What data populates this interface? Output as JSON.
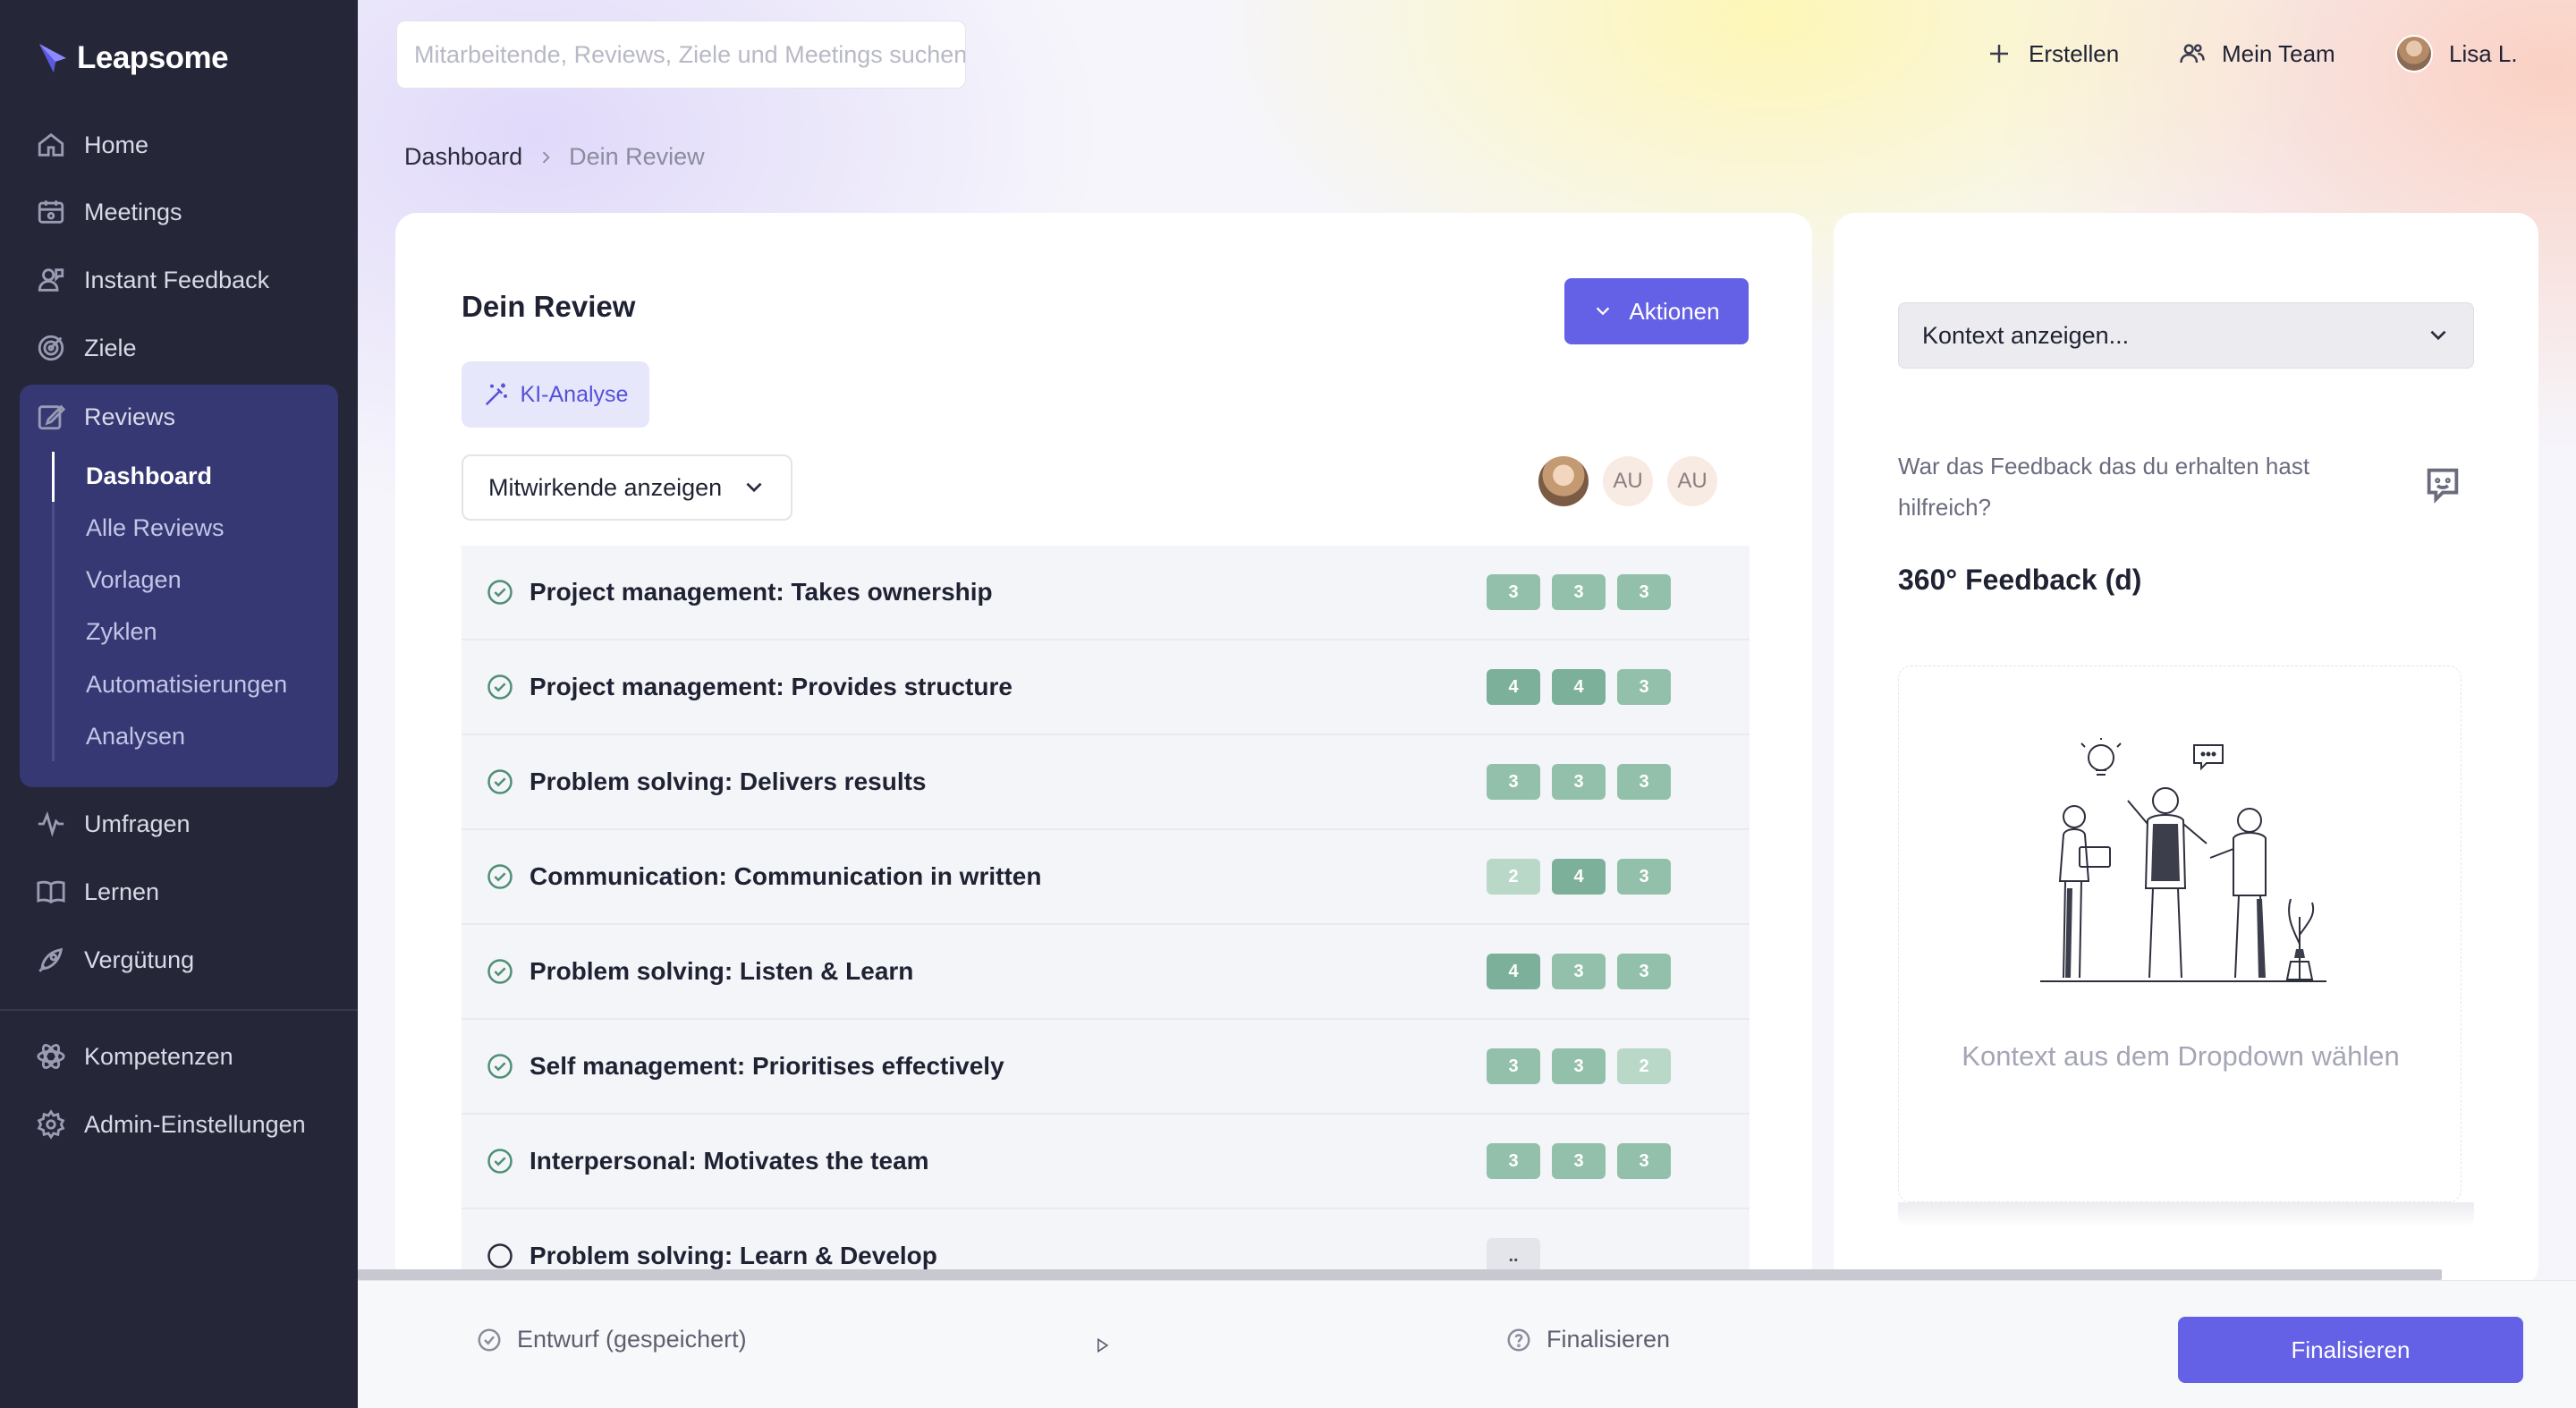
{
  "app": {
    "name": "Leapsome"
  },
  "sidebar": {
    "items": [
      {
        "label": "Home",
        "icon": "home-icon"
      },
      {
        "label": "Meetings",
        "icon": "meetings-icon"
      },
      {
        "label": "Instant Feedback",
        "icon": "feedback-icon"
      },
      {
        "label": "Ziele",
        "icon": "target-icon"
      },
      {
        "label": "Reviews",
        "icon": "reviews-icon"
      },
      {
        "label": "Umfragen",
        "icon": "pulse-icon"
      },
      {
        "label": "Lernen",
        "icon": "book-icon"
      },
      {
        "label": "Vergütung",
        "icon": "rocket-icon"
      },
      {
        "label": "Kompetenzen",
        "icon": "atom-icon"
      },
      {
        "label": "Admin-Einstellungen",
        "icon": "gear-icon"
      }
    ],
    "reviews_sub": [
      {
        "label": "Dashboard",
        "active": true
      },
      {
        "label": "Alle Reviews"
      },
      {
        "label": "Vorlagen"
      },
      {
        "label": "Zyklen"
      },
      {
        "label": "Automatisierungen"
      },
      {
        "label": "Analysen"
      }
    ]
  },
  "header": {
    "search_placeholder": "Mitarbeitende, Reviews, Ziele und Meetings suchen",
    "create_label": "Erstellen",
    "team_label": "Mein Team",
    "user_label": "Lisa L."
  },
  "breadcrumb": {
    "parent": "Dashboard",
    "current": "Dein Review"
  },
  "review": {
    "title": "Dein Review",
    "actions_label": "Aktionen",
    "ki_label": "KI-Analyse",
    "contributors_label": "Mitwirkende anzeigen",
    "avatars": [
      "photo",
      "AU",
      "AU"
    ],
    "rows": [
      {
        "label": "Project management: Takes ownership",
        "done": true,
        "scores": [
          "3",
          "3",
          "3"
        ]
      },
      {
        "label": "Project management: Provides structure",
        "done": true,
        "scores": [
          "4",
          "4",
          "3"
        ]
      },
      {
        "label": "Problem solving: Delivers results",
        "done": true,
        "scores": [
          "3",
          "3",
          "3"
        ]
      },
      {
        "label": "Communication: Communication in written",
        "done": true,
        "scores": [
          "2",
          "4",
          "3"
        ]
      },
      {
        "label": "Problem solving: Listen & Learn",
        "done": true,
        "scores": [
          "4",
          "3",
          "3"
        ]
      },
      {
        "label": "Self management: Prioritises effectively",
        "done": true,
        "scores": [
          "3",
          "3",
          "2"
        ]
      },
      {
        "label": "Interpersonal: Motivates the team",
        "done": true,
        "scores": [
          "3",
          "3",
          "3"
        ]
      },
      {
        "label": "Problem solving: Learn & Develop",
        "done": false,
        "scores": [
          ".."
        ]
      }
    ]
  },
  "context_panel": {
    "select_label": "Kontext anzeigen...",
    "question": "War das Feedback das du erhalten hast hilfreich?",
    "feedback_title": "360° Feedback (d)",
    "empty_text": "Kontext aus dem Dropdown wählen"
  },
  "footer": {
    "draft_label": "Entwurf (gespeichert)",
    "finalize_step": "Finalisieren",
    "finalize_button": "Finalisieren"
  },
  "colors": {
    "sidebar_bg": "#252637",
    "accent": "#6461e6",
    "reviews_active_bg": "#363874",
    "score_high": "#7db09a",
    "score_mid": "#93c0aa",
    "score_low": "#b9d8c8"
  }
}
